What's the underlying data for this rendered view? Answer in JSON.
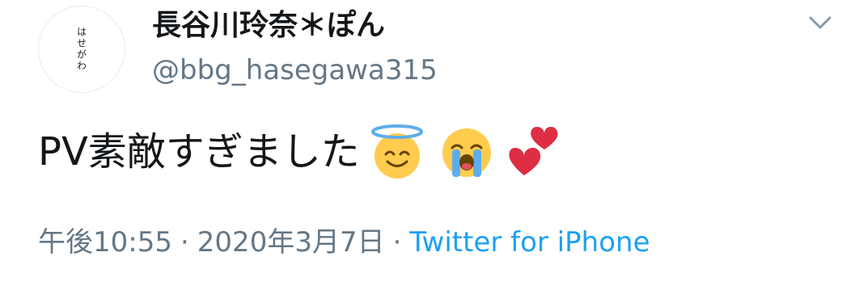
{
  "author": {
    "avatar_text": "はせがわ",
    "display_name": "長谷川玲奈＊ぽん",
    "handle": "@bbg_hasegawa315"
  },
  "tweet": {
    "text": "PV素敵すぎました",
    "emojis": [
      "smiling-face-with-halo",
      "loudly-crying-face",
      "two-hearts"
    ]
  },
  "meta": {
    "time": "午後10:55",
    "separator": "·",
    "date": "2020年3月7日",
    "source": "Twitter for iPhone"
  },
  "colors": {
    "text": "#14171a",
    "secondary": "#657786",
    "link": "#1da1f2"
  }
}
